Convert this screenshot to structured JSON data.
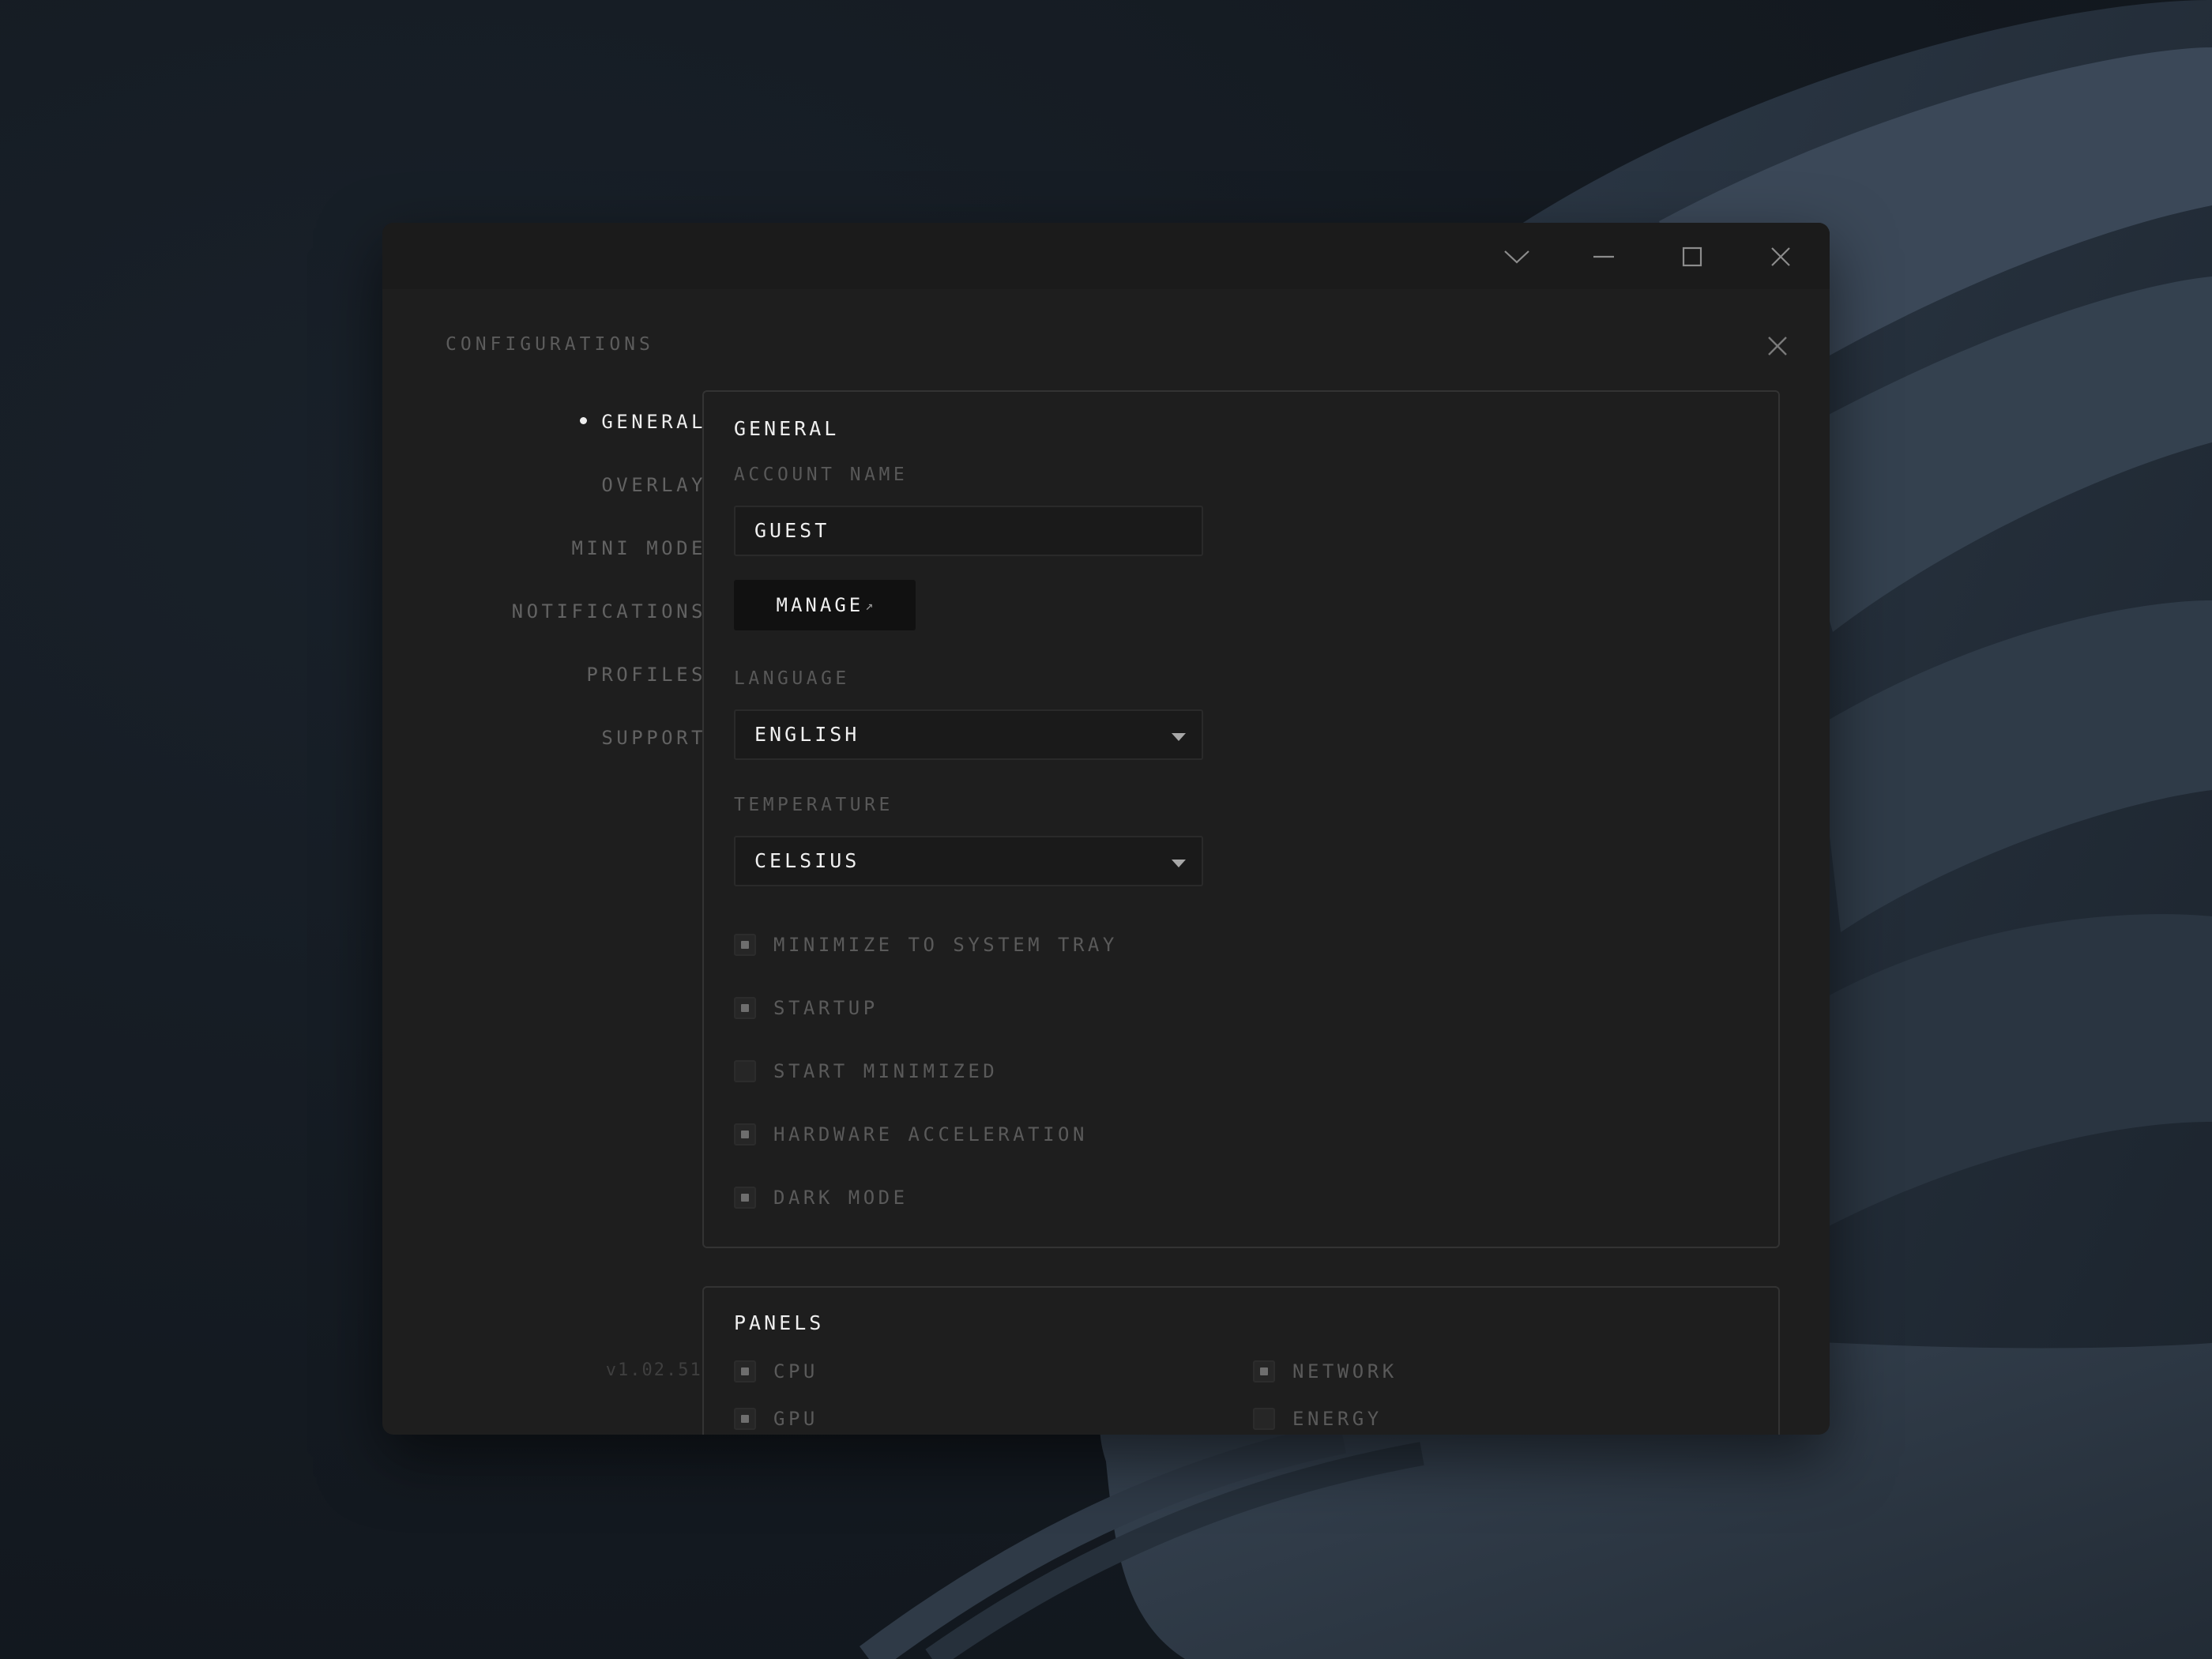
{
  "titlebar": {
    "icons": [
      "chevron-down-icon",
      "minimize-icon",
      "maximize-icon",
      "close-icon"
    ]
  },
  "sidebar": {
    "title": "CONFIGURATIONS",
    "items": [
      {
        "label": "GENERAL",
        "active": true
      },
      {
        "label": "OVERLAY",
        "active": false
      },
      {
        "label": "MINI MODE",
        "active": false
      },
      {
        "label": "NOTIFICATIONS",
        "active": false
      },
      {
        "label": "PROFILES",
        "active": false
      },
      {
        "label": "SUPPORT",
        "active": false
      }
    ],
    "version": "v1.02.512"
  },
  "general": {
    "title": "GENERAL",
    "account_label": "ACCOUNT NAME",
    "account_value": "GUEST",
    "manage_label": "MANAGE",
    "manage_icon": "external-link-icon",
    "language_label": "LANGUAGE",
    "language_value": "ENGLISH",
    "temperature_label": "TEMPERATURE",
    "temperature_value": "CELSIUS",
    "options": [
      {
        "label": "MINIMIZE TO SYSTEM TRAY",
        "checked": true
      },
      {
        "label": "STARTUP",
        "checked": true
      },
      {
        "label": "START MINIMIZED",
        "checked": false
      },
      {
        "label": "HARDWARE ACCELERATION",
        "checked": true
      },
      {
        "label": "DARK MODE",
        "checked": true
      }
    ]
  },
  "panels": {
    "title": "PANELS",
    "items": [
      {
        "label": "CPU",
        "checked": true
      },
      {
        "label": "NETWORK",
        "checked": true
      },
      {
        "label": "GPU",
        "checked": true
      },
      {
        "label": "ENERGY",
        "checked": false
      }
    ]
  },
  "colors": {
    "desktop": "#141a21",
    "window": "#1e1e1e",
    "text_active": "#eeeeee",
    "text_muted": "#5a5a5a"
  }
}
